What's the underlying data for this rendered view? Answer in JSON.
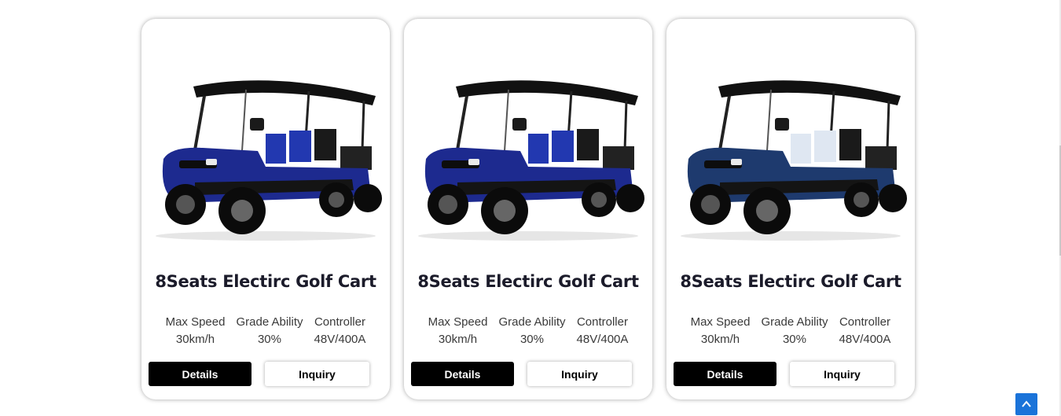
{
  "products": [
    {
      "title": "8Seats Electirc Golf Cart",
      "image_icon": "golf-cart-blue-image",
      "color": "#1d2a8f",
      "seat_color": "#2238b0",
      "specs": [
        {
          "label": "Max Speed",
          "value": "30km/h"
        },
        {
          "label": "Grade Ability",
          "value": "30%"
        },
        {
          "label": "Controller",
          "value": "48V/400A"
        }
      ],
      "details_label": "Details",
      "inquiry_label": "Inquiry"
    },
    {
      "title": "8Seats Electirc Golf Cart",
      "image_icon": "golf-cart-blue-image",
      "color": "#1d2a8f",
      "seat_color": "#2238b0",
      "specs": [
        {
          "label": "Max Speed",
          "value": "30km/h"
        },
        {
          "label": "Grade Ability",
          "value": "30%"
        },
        {
          "label": "Controller",
          "value": "48V/400A"
        }
      ],
      "details_label": "Details",
      "inquiry_label": "Inquiry"
    },
    {
      "title": "8Seats Electirc Golf Cart",
      "image_icon": "golf-cart-navy-white-seats-image",
      "color": "#1e3a6e",
      "seat_color": "#dfe7f2",
      "specs": [
        {
          "label": "Max Speed",
          "value": "30km/h"
        },
        {
          "label": "Grade Ability",
          "value": "30%"
        },
        {
          "label": "Controller",
          "value": "48V/400A"
        }
      ],
      "details_label": "Details",
      "inquiry_label": "Inquiry"
    }
  ],
  "back_to_top": {
    "icon": "chevron-up-icon",
    "color": "#1a73d9"
  }
}
